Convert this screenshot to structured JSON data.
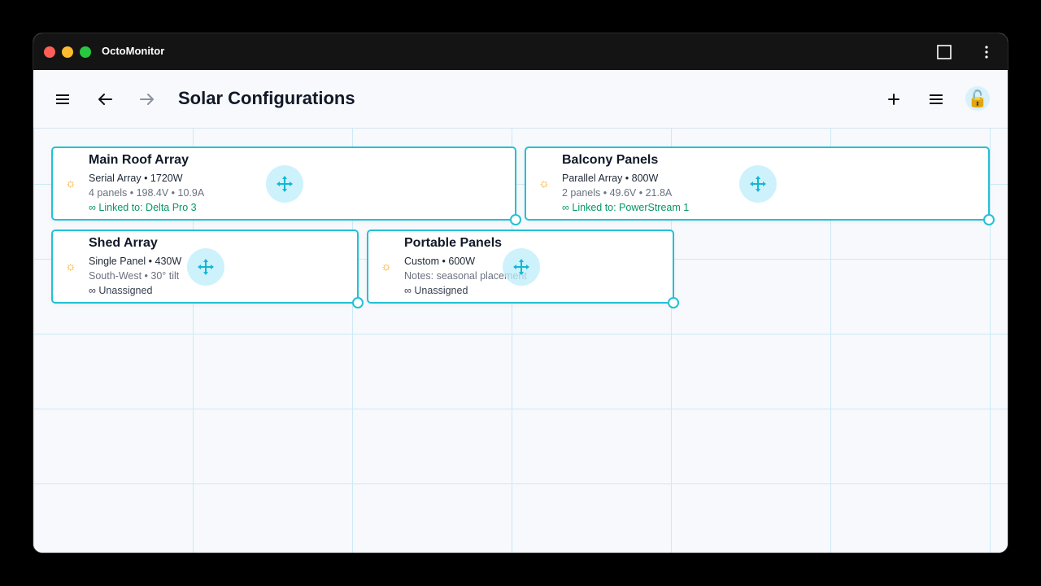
{
  "app": {
    "title": "OctoMonitor",
    "traffic_colors": [
      "#ff5f57",
      "#febc2e",
      "#28c840"
    ],
    "accent": "#22c1d6"
  },
  "header": {
    "title": "Solar Configurations",
    "icons": [
      "menu-icon",
      "back-arrow-icon",
      "forward-arrow-icon",
      "plus-icon",
      "list-icon",
      "lock-icon"
    ]
  },
  "cards": [
    {
      "name": "Main Roof Array",
      "line1": "Serial Array • 1720W",
      "line2": "4 panels • 198.4V • 10.9A",
      "line3": "∞ Linked to: Delta Pro 3",
      "linked": true
    },
    {
      "name": "Balcony Panels",
      "line1": "Parallel Array • 800W",
      "line2": "2 panels • 49.6V • 21.8A",
      "line3": "∞ Linked to: PowerStream 1",
      "linked": true
    },
    {
      "name": "Shed Array",
      "line1": "Single Panel • 430W",
      "line2": "South-West • 30° tilt",
      "line3": "∞ Unassigned",
      "linked": false
    },
    {
      "name": "Portable Panels",
      "line1": "Custom • 600W",
      "line2": "Notes: seasonal placement",
      "line3": "∞ Unassigned",
      "linked": false
    }
  ]
}
